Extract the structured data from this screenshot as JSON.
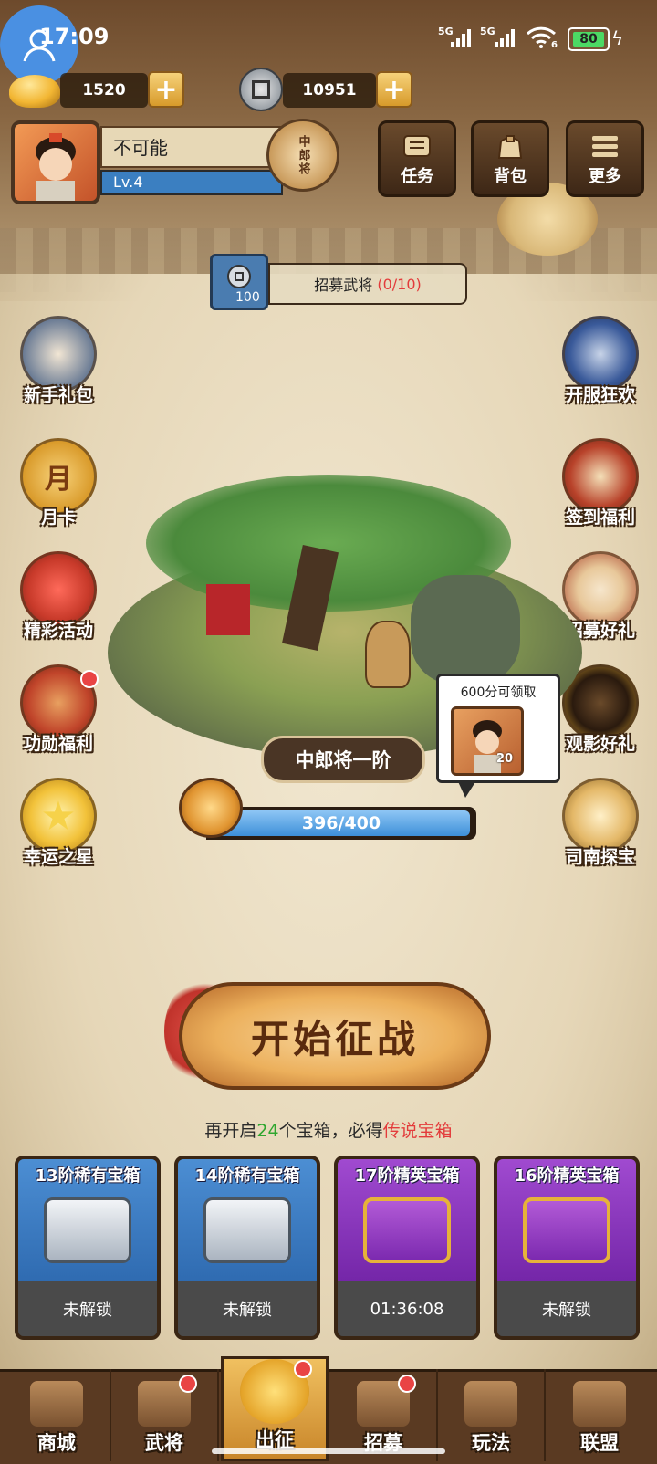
{
  "status_bar": {
    "time": "17:09",
    "signal1": "5G",
    "signal2": "5G",
    "wifi_badge": "6",
    "battery": "80"
  },
  "currencies": {
    "gold": "1520",
    "copper": "10951"
  },
  "player": {
    "name": "不可能",
    "level": "Lv.4",
    "rank_badge": "中郎将"
  },
  "top_buttons": [
    {
      "label": "任务",
      "icon": "scroll-icon"
    },
    {
      "label": "背包",
      "icon": "bag-icon"
    },
    {
      "label": "更多",
      "icon": "menu-icon"
    }
  ],
  "recruit": {
    "cost": "100",
    "label": "招募武将",
    "progress": "(0/10)"
  },
  "left_icons": [
    {
      "label": "新手礼包",
      "icon": "hero-gift-icon",
      "badge": false
    },
    {
      "label": "月卡",
      "icon": "month-card-icon",
      "badge": false
    },
    {
      "label": "精彩活动",
      "icon": "event-bag-icon",
      "badge": false
    },
    {
      "label": "功勋福利",
      "icon": "merit-bag-icon",
      "badge": true
    },
    {
      "label": "幸运之星",
      "icon": "lucky-star-icon",
      "badge": false
    }
  ],
  "right_icons": [
    {
      "label": "开服狂欢",
      "icon": "server-carnival-icon"
    },
    {
      "label": "签到福利",
      "icon": "sign-in-icon"
    },
    {
      "label": "招募好礼",
      "icon": "drum-icon"
    },
    {
      "label": "观影好礼",
      "icon": "video-gift-icon"
    },
    {
      "label": "司南探宝",
      "icon": "compass-icon"
    }
  ],
  "stage": {
    "rank_name": "中郎将一阶",
    "progress_text": "396/400",
    "progress_current": 396,
    "progress_max": 400,
    "reward_bubble": "600分可领取",
    "reward_count": "20"
  },
  "start_button": "开始征战",
  "hint": {
    "prefix": "再开启",
    "count": "24",
    "middle": "个宝箱，必得",
    "highlight": "传说宝箱"
  },
  "chests": [
    {
      "title": "13阶稀有宝箱",
      "status": "未解锁",
      "type": "blue"
    },
    {
      "title": "14阶稀有宝箱",
      "status": "未解锁",
      "type": "blue"
    },
    {
      "title": "17阶精英宝箱",
      "status": "01:36:08",
      "type": "purple"
    },
    {
      "title": "16阶精英宝箱",
      "status": "未解锁",
      "type": "purple"
    }
  ],
  "nav": [
    {
      "label": "商城",
      "badge": false
    },
    {
      "label": "武将",
      "badge": true
    },
    {
      "label": "出征",
      "badge": true,
      "active": true
    },
    {
      "label": "招募",
      "badge": true
    },
    {
      "label": "玩法",
      "badge": false
    },
    {
      "label": "联盟",
      "badge": false
    }
  ]
}
